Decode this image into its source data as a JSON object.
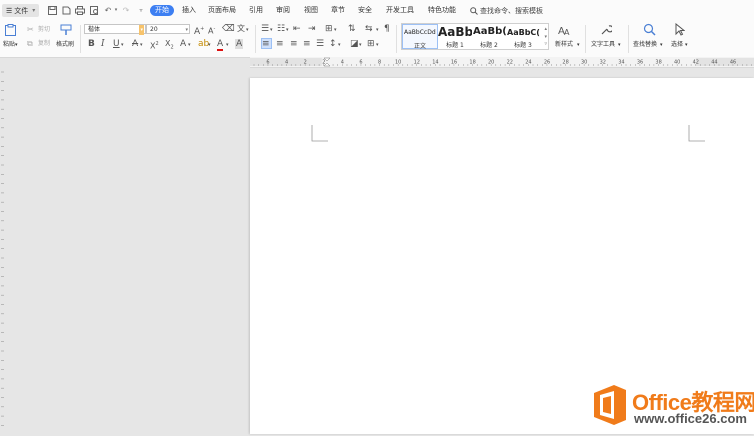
{
  "menubar": {
    "file_label": "文件",
    "tabs": [
      "开始",
      "插入",
      "页面布局",
      "引用",
      "审阅",
      "视图",
      "章节",
      "安全",
      "开发工具",
      "特色功能"
    ],
    "active_tab": "开始",
    "search_label": "查找命令、搜索模板"
  },
  "ribbon": {
    "paste_label": "粘贴",
    "cut_label": "剪切",
    "copy_label": "复制",
    "format_painter_label": "格式刷",
    "font_name": "楷体",
    "font_size": "20",
    "styles": [
      {
        "sample": "AaBbCcDd",
        "name": "正文"
      },
      {
        "sample": "AaBb",
        "name": "标题 1"
      },
      {
        "sample": "AaBb(",
        "name": "标题 2"
      },
      {
        "sample": "AaBbC(",
        "name": "标题 3"
      }
    ],
    "new_style_label": "新样式",
    "text_tools_label": "文字工具",
    "find_replace_label": "查找替换",
    "select_label": "选择"
  },
  "ruler": {
    "labels": [
      "6",
      "4",
      "2",
      "2",
      "4",
      "6",
      "8",
      "10",
      "12",
      "14",
      "16",
      "18",
      "20",
      "22",
      "24",
      "26",
      "28",
      "30",
      "32",
      "34",
      "36",
      "38",
      "40",
      "42",
      "44",
      "46"
    ]
  },
  "watermark": {
    "title": "Office教程网",
    "url": "www.office26.com"
  },
  "colors": {
    "accent": "#3d7ff2",
    "watermark_orange": "#f07b1a"
  }
}
